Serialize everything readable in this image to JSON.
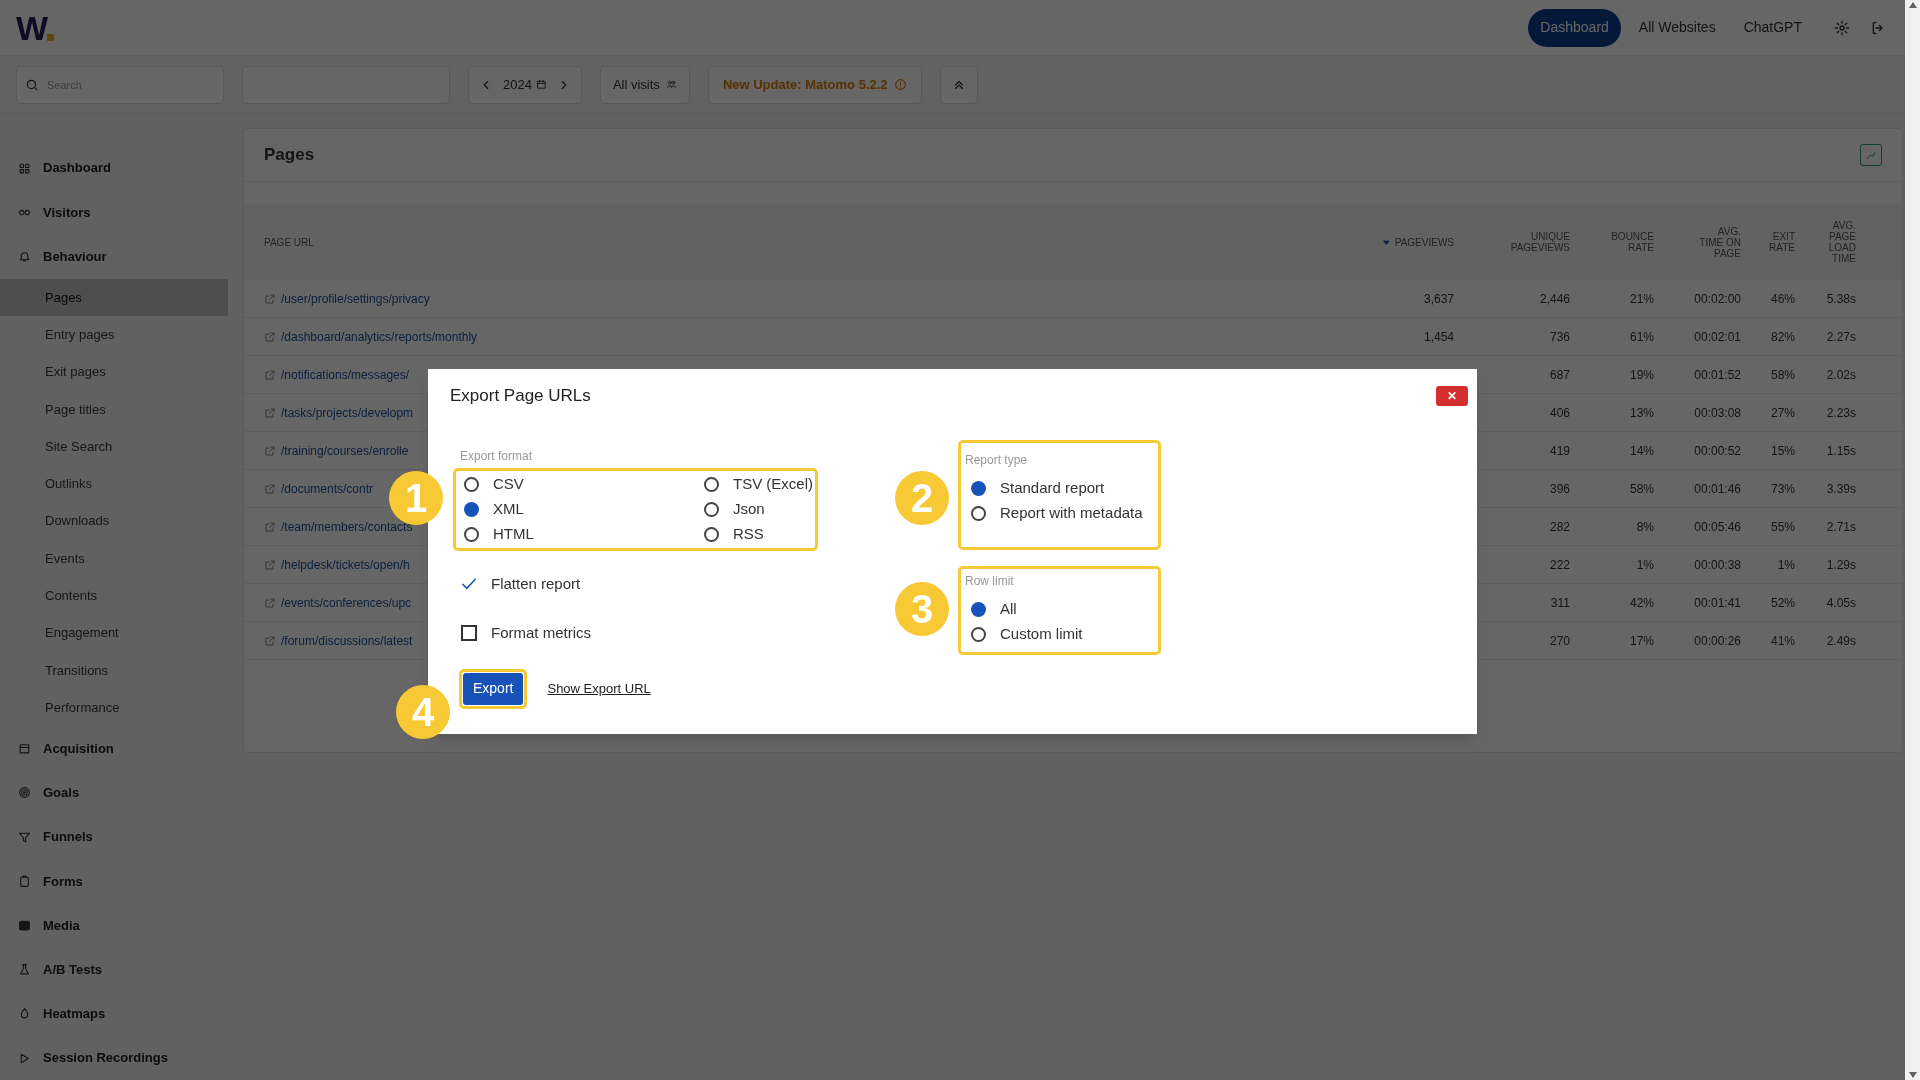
{
  "header": {
    "logo": "W",
    "nav": [
      {
        "label": "Dashboard",
        "selected": true
      },
      {
        "label": "All Websites",
        "selected": false
      },
      {
        "label": "ChatGPT",
        "selected": false
      }
    ]
  },
  "toolbar": {
    "search_placeholder": "Search",
    "date": "2024",
    "segment": "All visits",
    "update": "New Update: Matomo 5.2.2"
  },
  "sidebar": [
    {
      "label": "Dashboard"
    },
    {
      "label": "Visitors"
    },
    {
      "label": "Behaviour",
      "children": [
        {
          "label": "Pages",
          "selected": true
        },
        {
          "label": "Entry pages",
          "selected": false
        },
        {
          "label": "Exit pages",
          "selected": false
        },
        {
          "label": "Page titles",
          "selected": false
        },
        {
          "label": "Site Search",
          "selected": false
        },
        {
          "label": "Outlinks",
          "selected": false
        },
        {
          "label": "Downloads",
          "selected": false
        },
        {
          "label": "Events",
          "selected": false
        },
        {
          "label": "Contents",
          "selected": false
        },
        {
          "label": "Engagement",
          "selected": false
        },
        {
          "label": "Transitions",
          "selected": false
        },
        {
          "label": "Performance",
          "selected": false
        }
      ]
    },
    {
      "label": "Acquisition"
    },
    {
      "label": "Goals"
    },
    {
      "label": "Funnels"
    },
    {
      "label": "Forms"
    },
    {
      "label": "Media"
    },
    {
      "label": "A/B Tests"
    },
    {
      "label": "Heatmaps"
    },
    {
      "label": "Session Recordings"
    }
  ],
  "report": {
    "title": "Pages",
    "columns": [
      {
        "label": "PAGE URL",
        "sorted": false
      },
      {
        "label": "PAGEVIEWS",
        "sorted": true
      },
      {
        "label": "UNIQUE PAGEVIEWS",
        "sorted": false
      },
      {
        "label": "BOUNCE RATE",
        "sorted": false
      },
      {
        "label": "AVG. TIME ON PAGE",
        "sorted": false
      },
      {
        "label": "EXIT RATE",
        "sorted": false
      },
      {
        "label": "AVG. PAGE LOAD TIME",
        "sorted": false
      }
    ],
    "rows": [
      {
        "url": "/user/profile/settings/privacy",
        "pageviews": "3,637",
        "values": [
          "2,446",
          "21%",
          "00:02:00",
          "46%",
          "5.38s"
        ]
      },
      {
        "url": "/dashboard/analytics/reports/monthly",
        "pageviews": "1,454",
        "values": [
          "736",
          "61%",
          "00:02:01",
          "82%",
          "2.27s"
        ]
      },
      {
        "url": "/notifications/messages/",
        "values": [
          "687",
          "19%",
          "00:01:52",
          "58%",
          "2.02s"
        ]
      },
      {
        "url": "/tasks/projects/developm",
        "values": [
          "406",
          "13%",
          "00:03:08",
          "27%",
          "2.23s"
        ]
      },
      {
        "url": "/training/courses/enrolle",
        "values": [
          "419",
          "14%",
          "00:00:52",
          "15%",
          "1.15s"
        ]
      },
      {
        "url": "/documents/contr",
        "values": [
          "396",
          "58%",
          "00:01:46",
          "73%",
          "3.39s"
        ]
      },
      {
        "url": "/team/members/contacts",
        "values": [
          "282",
          "8%",
          "00:05:46",
          "55%",
          "2.71s"
        ]
      },
      {
        "url": "/helpdesk/tickets/open/h",
        "values": [
          "222",
          "1%",
          "00:00:38",
          "1%",
          "1.29s"
        ]
      },
      {
        "url": "/events/conferences/upc",
        "values": [
          "311",
          "42%",
          "00:01:41",
          "52%",
          "4.05s"
        ]
      },
      {
        "url": "/forum/discussions/latest",
        "values": [
          "270",
          "17%",
          "00:00:26",
          "41%",
          "2.49s"
        ]
      }
    ]
  },
  "dialog": {
    "title": "Export Page URLs",
    "close": "✕",
    "export_format": {
      "label": "Export format",
      "options": [
        {
          "label": "CSV",
          "selected": false
        },
        {
          "label": "TSV (Excel)",
          "selected": false
        },
        {
          "label": "XML",
          "selected": true
        },
        {
          "label": "Json",
          "selected": false
        },
        {
          "label": "HTML",
          "selected": false
        },
        {
          "label": "RSS",
          "selected": false
        }
      ]
    },
    "checkboxes": [
      {
        "label": "Flatten report",
        "checked": true
      },
      {
        "label": "Format metrics",
        "checked": false
      }
    ],
    "report_type": {
      "label": "Report type",
      "options": [
        {
          "label": "Standard report",
          "selected": true
        },
        {
          "label": "Report with metadata",
          "selected": false
        }
      ]
    },
    "row_limit": {
      "label": "Row limit",
      "options": [
        {
          "label": "All",
          "selected": true
        },
        {
          "label": "Custom limit",
          "selected": false
        }
      ]
    },
    "export_button": "Export",
    "link": "Show Export URL",
    "markers": [
      "1",
      "2",
      "3",
      "4"
    ]
  }
}
